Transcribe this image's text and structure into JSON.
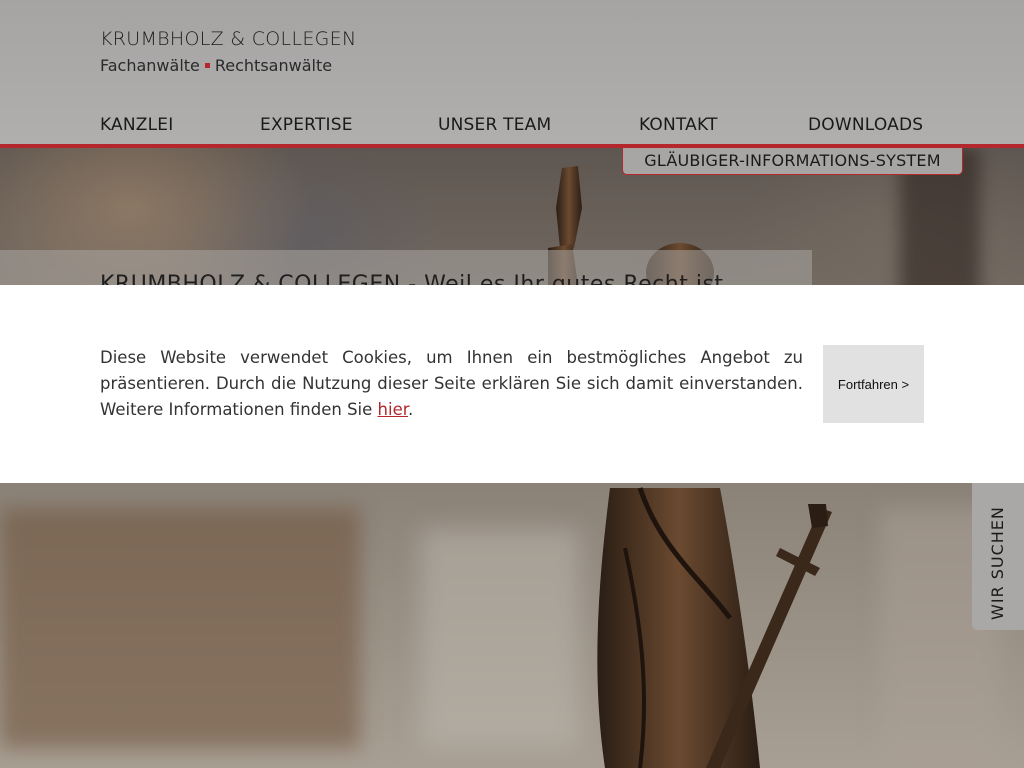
{
  "brand": {
    "name": "KRUMBHOLZ & COLLEGEN",
    "sub_left": "Fachanwälte",
    "sub_right": "Rechtsanwälte"
  },
  "nav": {
    "items": [
      {
        "label": "KANZLEI"
      },
      {
        "label": "EXPERTISE"
      },
      {
        "label": "UNSER TEAM"
      },
      {
        "label": "KONTAKT"
      },
      {
        "label": "DOWNLOADS"
      }
    ],
    "gis_label": "GLÄUBIGER-INFORMATIONS-SYSTEM"
  },
  "hero": {
    "tagline": "KRUMBHOLZ & COLLEGEN - Weil es Ihr gutes Recht ist"
  },
  "side_tab": {
    "label": "WIR SUCHEN"
  },
  "cookie": {
    "text_before": "Diese Website verwendet Cookies, um Ihnen ein bestmögliches Angebot zu präsentieren. Durch die Nutzung dieser Seite erklären Sie sich damit einverstanden. Weitere Informationen finden Sie ",
    "link_label": "hier",
    "text_after": ".",
    "button_label": "Fortfahren >"
  },
  "colors": {
    "accent": "#b5272c",
    "header_bg": "#a8a7a6",
    "button_bg": "#e1e1e1"
  }
}
